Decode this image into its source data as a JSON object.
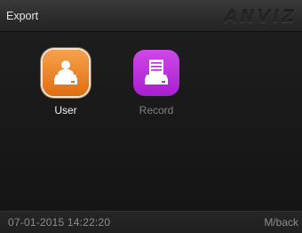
{
  "header": {
    "title": "Export",
    "brand": "ANVIZ"
  },
  "menu": {
    "items": [
      {
        "label": "User",
        "icon": "user-export-icon",
        "color": "#ec8a30",
        "selected": true
      },
      {
        "label": "Record",
        "icon": "record-export-icon",
        "color": "#bd33de",
        "selected": false
      }
    ]
  },
  "status": {
    "datetime": "07-01-2015 14:22:20",
    "hint": "M/back"
  }
}
